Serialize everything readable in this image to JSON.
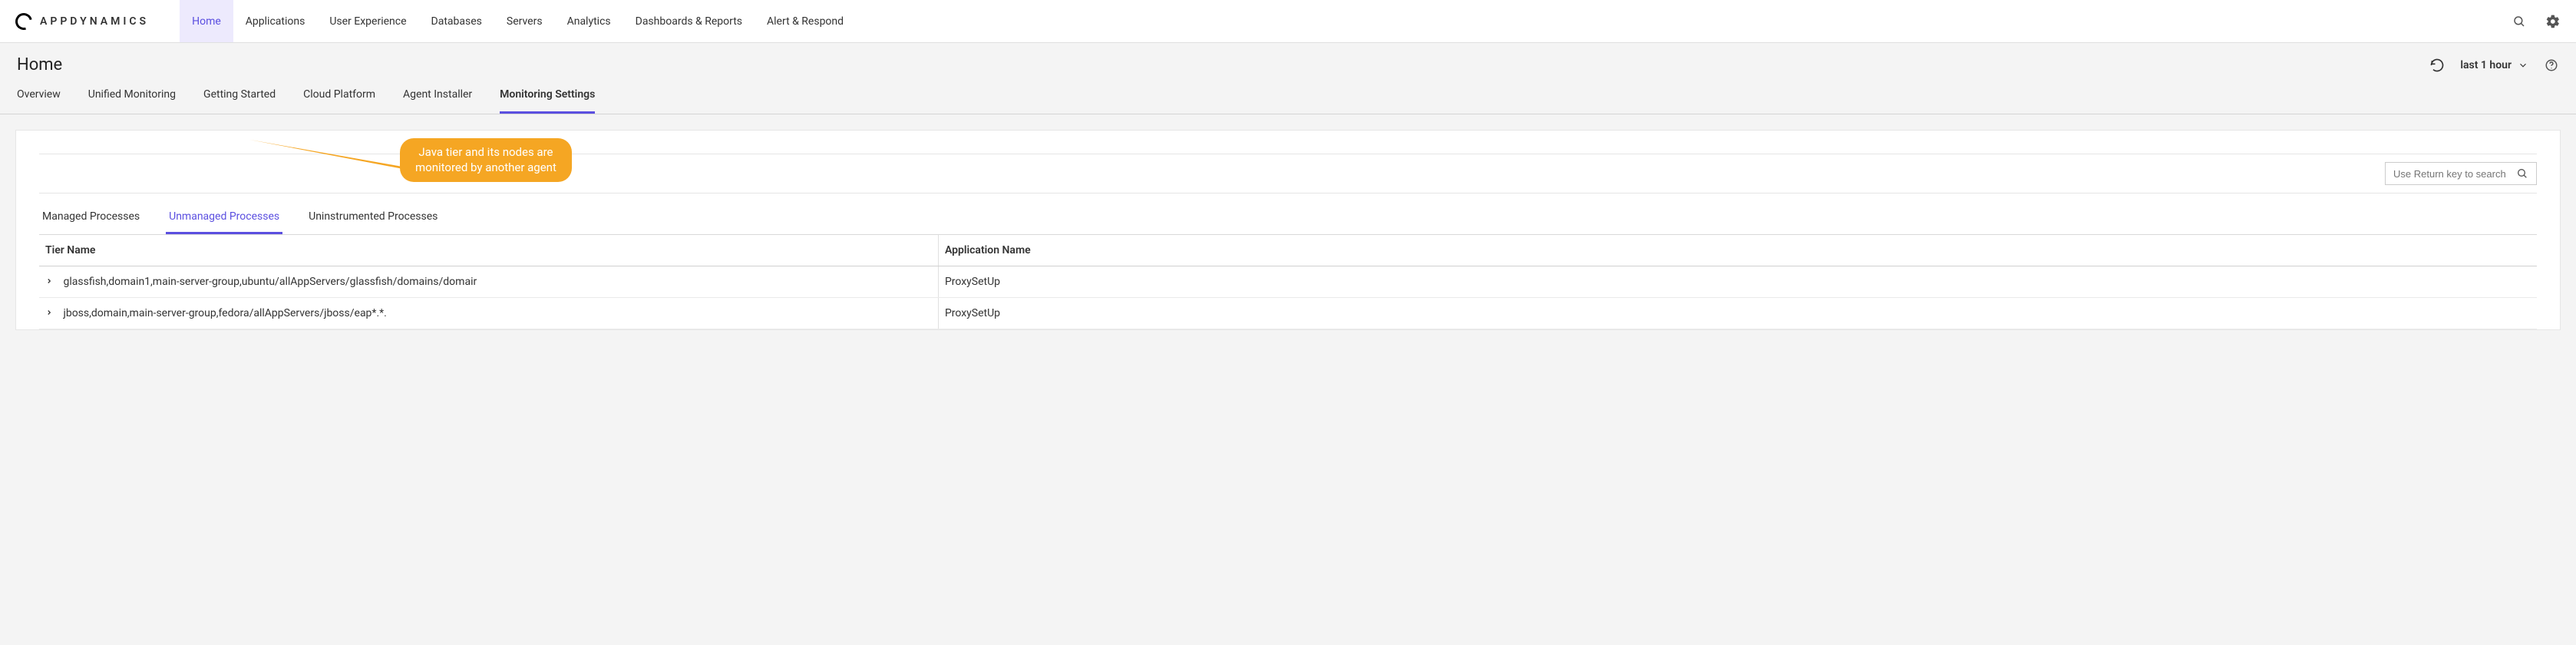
{
  "brand": {
    "name": "APPDYNAMICS"
  },
  "topnav": {
    "items": [
      {
        "label": "Home",
        "active": true
      },
      {
        "label": "Applications"
      },
      {
        "label": "User Experience"
      },
      {
        "label": "Databases"
      },
      {
        "label": "Servers"
      },
      {
        "label": "Analytics"
      },
      {
        "label": "Dashboards & Reports"
      },
      {
        "label": "Alert & Respond"
      }
    ]
  },
  "page": {
    "title": "Home",
    "time_range": "last 1 hour"
  },
  "subnav": {
    "items": [
      {
        "label": "Overview"
      },
      {
        "label": "Unified Monitoring"
      },
      {
        "label": "Getting Started"
      },
      {
        "label": "Cloud Platform"
      },
      {
        "label": "Agent Installer"
      },
      {
        "label": "Monitoring Settings",
        "active": true
      }
    ]
  },
  "callout": {
    "line1": "Java tier and its nodes are",
    "line2": "monitored by another agent"
  },
  "search": {
    "placeholder": "Use Return key to search"
  },
  "inner_tabs": {
    "items": [
      {
        "label": "Managed Processes"
      },
      {
        "label": "Unmanaged Processes",
        "active": true
      },
      {
        "label": "Uninstrumented Processes"
      }
    ]
  },
  "table": {
    "headers": {
      "tier": "Tier Name",
      "app": "Application Name"
    },
    "rows": [
      {
        "tier": "glassfish,domain1,main-server-group,ubuntu/allAppServers/glassfish/domains/domair",
        "app": "ProxySetUp"
      },
      {
        "tier": "jboss,domain,main-server-group,fedora/allAppServers/jboss/eap*.*.",
        "app": "ProxySetUp"
      }
    ]
  }
}
